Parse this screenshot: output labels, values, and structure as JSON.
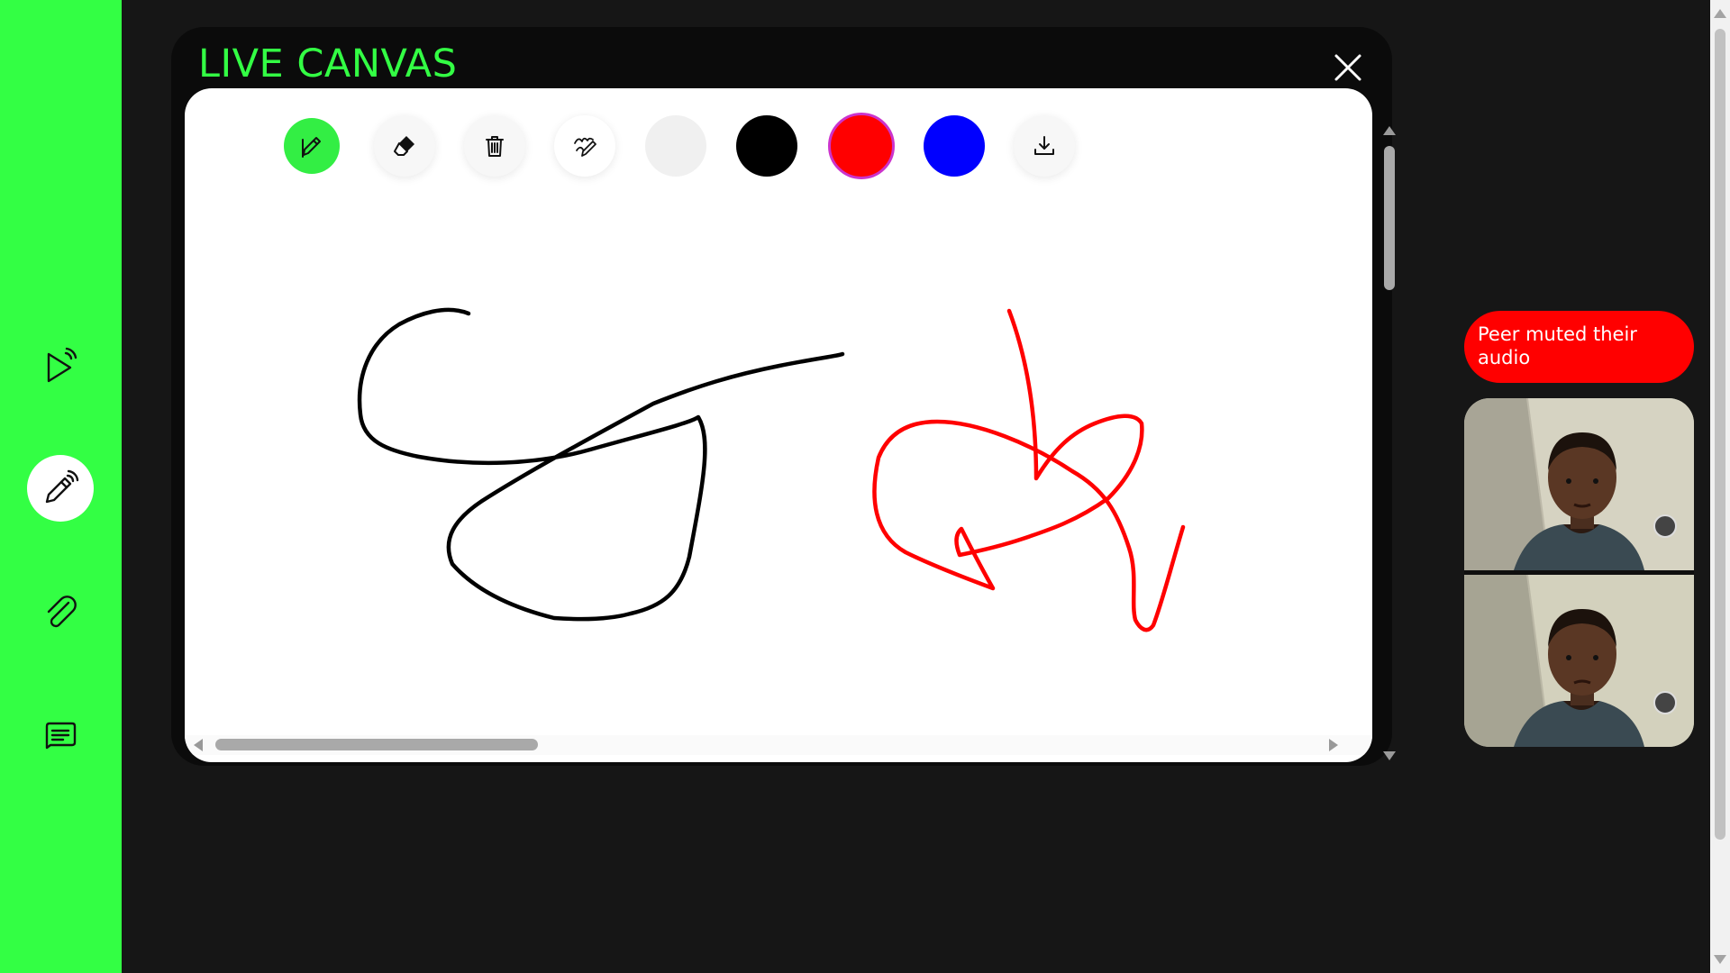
{
  "sidebar": {
    "items": [
      {
        "id": "stream",
        "icon": "play-broadcast-icon",
        "active": false
      },
      {
        "id": "whiteboard",
        "icon": "pencil-broadcast-icon",
        "active": true
      },
      {
        "id": "attachments",
        "icon": "paperclip-icon",
        "active": false
      },
      {
        "id": "chat",
        "icon": "chat-message-icon",
        "active": false
      }
    ],
    "accent": "#33ff44"
  },
  "canvas_modal": {
    "title": "LIVE CANVAS",
    "title_color": "#33ff44",
    "close_icon": "close-icon",
    "toolbar": {
      "tools": [
        {
          "id": "pencil",
          "icon": "pencil-icon",
          "selected": true
        },
        {
          "id": "eraser",
          "icon": "eraser-icon",
          "selected": false
        },
        {
          "id": "clear",
          "icon": "trash-icon",
          "selected": false
        },
        {
          "id": "auto-draw",
          "icon": "scribble-pencil-icon",
          "selected": false
        }
      ],
      "colors": [
        {
          "id": "color-light-gray",
          "hex": "#f0f0f0",
          "selected": false
        },
        {
          "id": "color-black",
          "hex": "#000000",
          "selected": false
        },
        {
          "id": "color-red",
          "hex": "#ff0000",
          "selected": true
        },
        {
          "id": "color-blue",
          "hex": "#0000ff",
          "selected": false
        }
      ],
      "download_icon": "download-icon"
    },
    "strokes": [
      {
        "color": "#000000",
        "description_id": "black-stroke"
      },
      {
        "color": "#ff0000",
        "description_id": "red-stroke"
      }
    ]
  },
  "notification": {
    "text": "Peer muted their audio",
    "background": "#ff0000"
  },
  "video_feeds": [
    {
      "id": "remote-video"
    },
    {
      "id": "local-video"
    }
  ]
}
